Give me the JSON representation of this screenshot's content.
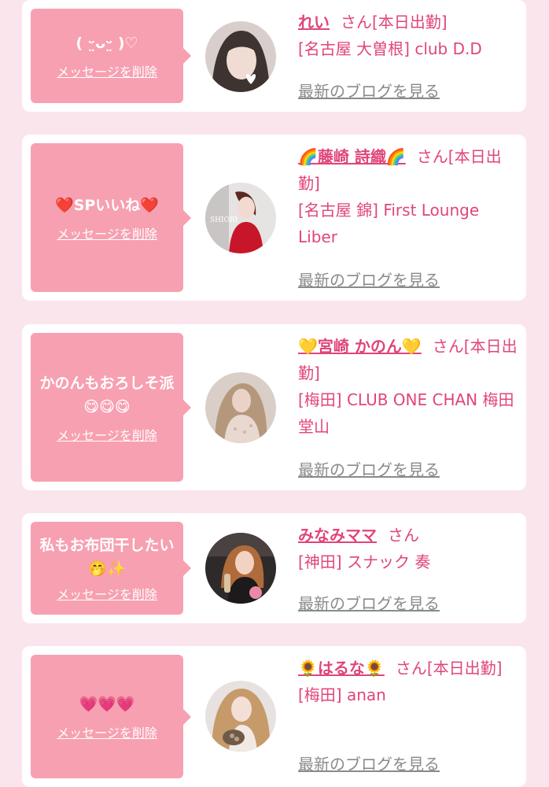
{
  "colors": {
    "page_bg": "#fbe5ec",
    "card_bg": "#ffffff",
    "bubble_bg": "#f7a0b1",
    "accent": "#e0457a",
    "link_gray": "#8a8a8a"
  },
  "items": [
    {
      "message": "( ᵕ̤ᴗᵕ̤ )♡",
      "delete_label": "メッセージを削除",
      "name": "れい",
      "san": "さん",
      "status": "[本日出勤]",
      "shop": "[名古屋 大曽根] club D.D",
      "blog_label": "最新のブログを見る",
      "avatar_icon": "woman-photo-heart-icon"
    },
    {
      "message": "❤️SPいいね❤️",
      "delete_label": "メッセージを削除",
      "name": "🌈藤崎 詩織🌈",
      "san": "さん",
      "status": "[本日出勤]",
      "shop": "[名古屋 錦] First Lounge Liber",
      "blog_label": "最新のブログを見る",
      "avatar_icon": "woman-red-dress-photo-icon"
    },
    {
      "message": "かのんもおろしそ派😋😋😋",
      "delete_label": "メッセージを削除",
      "name": "💛宮崎 かのん💛",
      "san": "さん",
      "status": "[本日出勤]",
      "shop": "[梅田] CLUB ONE CHAN 梅田堂山",
      "blog_label": "最新のブログを見る",
      "avatar_icon": "woman-lace-dress-photo-icon"
    },
    {
      "message": "私もお布団干したい🤭✨",
      "delete_label": "メッセージを削除",
      "name": "みなみママ",
      "san": "さん",
      "status": "",
      "shop": "[神田] スナック 奏",
      "blog_label": "最新のブログを見る",
      "avatar_icon": "woman-drink-photo-icon"
    },
    {
      "message": "💗💗💗",
      "delete_label": "メッセージを削除",
      "name": "🌻はるな🌻",
      "san": "さん",
      "status": "[本日出勤]",
      "shop": "[梅田] anan",
      "blog_label": "最新のブログを見る",
      "avatar_icon": "woman-selfie-photo-icon"
    }
  ]
}
